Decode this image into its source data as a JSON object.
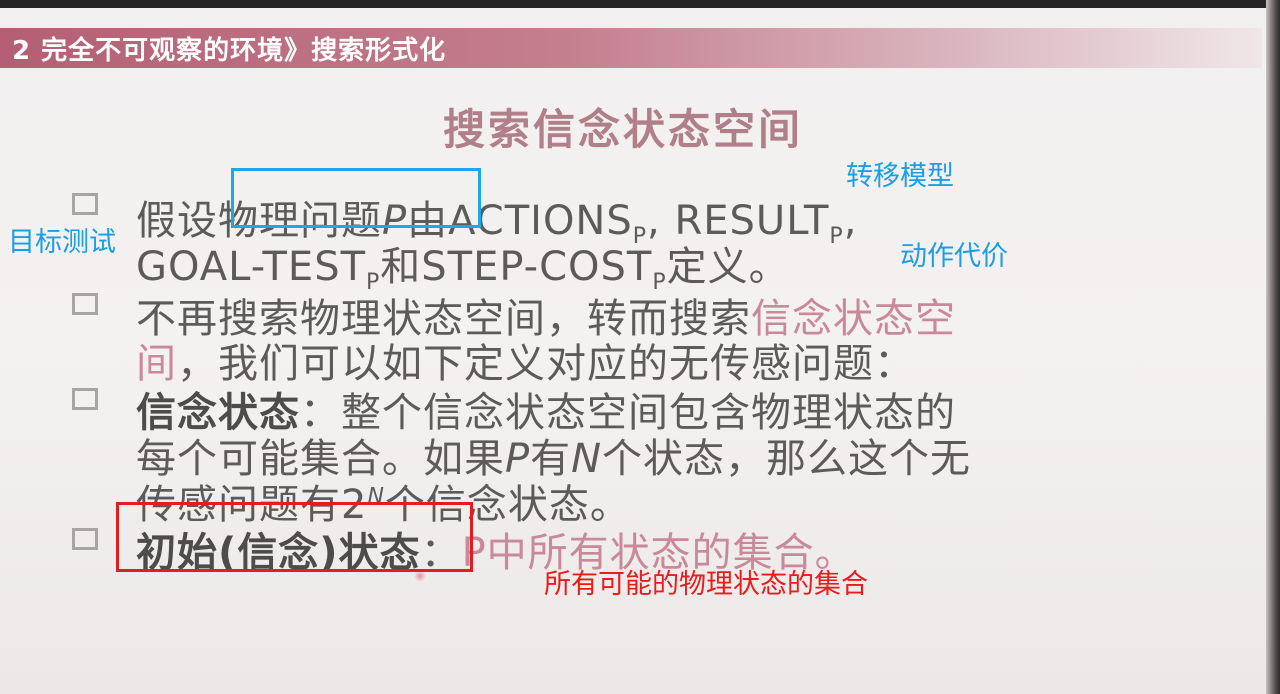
{
  "header": {
    "text": "2 完全不可观察的环境》搜索形式化"
  },
  "title": "搜索信念状态空间",
  "bullets": [
    {
      "line1": {
        "prefix": "假设物理问题",
        "p": "P",
        "mid": "由ACTIONS",
        "sub1": "P",
        "mid2": ", RESULT",
        "sub2": "P",
        "tail": ","
      },
      "line2": {
        "a": "GOAL-TEST",
        "sub1": "P",
        "b": "和STEP-COST",
        "sub2": "P",
        "c": "定义。"
      }
    },
    {
      "line1": {
        "a": "不再搜索物理状态空间，转而搜索",
        "hl": "信念状态空"
      },
      "line2": {
        "hl": "间",
        "b": "，我们可以如下定义对应的无传感问题："
      }
    },
    {
      "line1": {
        "bold": "信念状态",
        "rest": "：整个信念状态空间包含物理状态的"
      },
      "line2": {
        "a": "每个可能集合。如果",
        "p": "P",
        "b": "有",
        "n": "N",
        "c": "个状态，那么这个无"
      },
      "line3": {
        "a": "传感问题有2",
        "sup": "N",
        "b": "个信念状态。"
      }
    },
    {
      "line1": {
        "bold": "初始(信念)状态",
        "sep": "：",
        "hl": "P中所有状态的集合。"
      }
    }
  ],
  "annotations": {
    "transition_model": "转移模型",
    "goal_test": "目标测试",
    "action_cost": "动作代价",
    "initial_state_note": "所有可能的物理状态的集合"
  },
  "colors": {
    "header_bar": "#b45f73",
    "title": "#b07f88",
    "body_text": "#5d5a5a",
    "highlight_text": "#c9899a",
    "annotation_blue": "#1a9ee4",
    "annotation_red": "#ea1b1b"
  }
}
